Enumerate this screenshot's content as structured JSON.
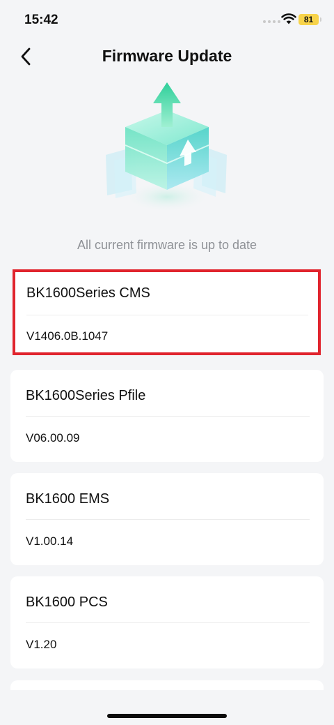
{
  "status_bar": {
    "time": "15:42",
    "battery": "81"
  },
  "header": {
    "title": "Firmware Update",
    "back_icon": "chevron-left-icon"
  },
  "hero": {
    "icon": "upload-box-illustration",
    "message": "All current firmware is up to date"
  },
  "firmware_items": [
    {
      "name": "BK1600Series CMS",
      "version": "V1406.0B.1047",
      "highlighted": true
    },
    {
      "name": "BK1600Series Pfile",
      "version": "V06.00.09"
    },
    {
      "name": "BK1600 EMS",
      "version": "V1.00.14"
    },
    {
      "name": "BK1600 PCS",
      "version": "V1.20"
    }
  ],
  "colors": {
    "background": "#f4f5f7",
    "highlight_border": "#e0242d",
    "battery": "#f7d34a",
    "accent_teal": "#3fd6b0"
  }
}
